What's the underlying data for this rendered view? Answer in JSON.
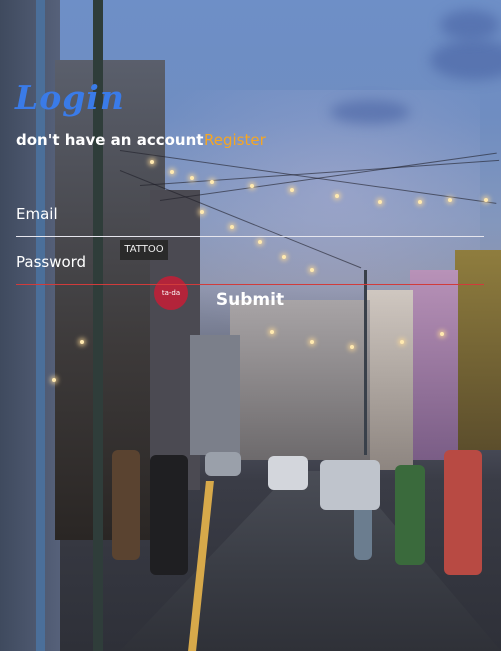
{
  "form": {
    "title": "Login",
    "account_prompt": "don't have an account",
    "register_label": "Register",
    "email_placeholder": "Email",
    "password_placeholder": "Password",
    "submit_label": "Submit"
  },
  "background": {
    "description_icon": "street-photo",
    "signs": {
      "tattoo": "TATTOO",
      "heart": "ta-da"
    }
  },
  "colors": {
    "title": "#3a7be8",
    "register": "#f5a623",
    "password_underline": "#d13b3b",
    "email_underline": "#e6e6ee"
  }
}
